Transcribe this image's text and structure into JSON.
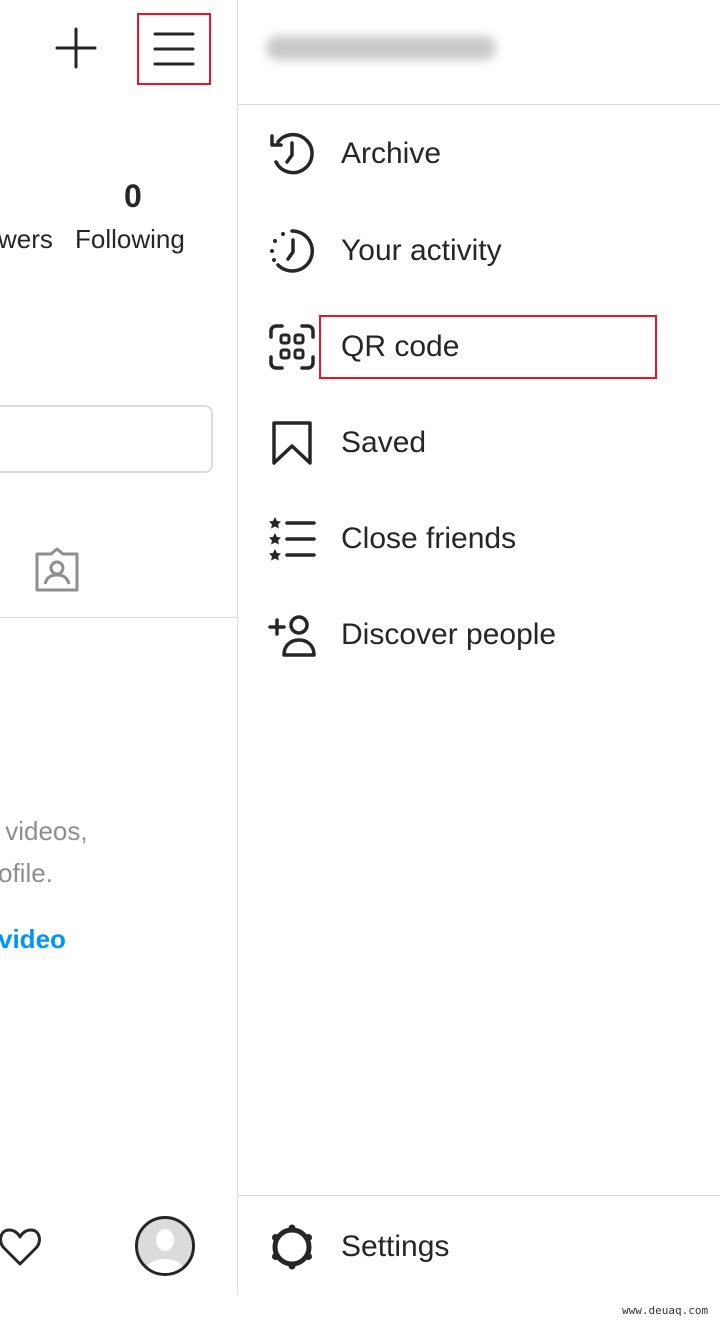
{
  "profile": {
    "stats": [
      {
        "label_partial": "wers"
      },
      {
        "value": "0",
        "label": "Following"
      }
    ],
    "empty_text_line1": " videos,",
    "empty_text_line2": "ofile.",
    "empty_link": "video"
  },
  "drawer": {
    "username_blurred": "",
    "items": [
      {
        "label": "Archive",
        "icon": "archive-icon"
      },
      {
        "label": "Your activity",
        "icon": "activity-icon"
      },
      {
        "label": "QR code",
        "icon": "qr-code-icon"
      },
      {
        "label": "Saved",
        "icon": "bookmark-icon"
      },
      {
        "label": "Close friends",
        "icon": "close-friends-icon"
      },
      {
        "label": "Discover people",
        "icon": "add-person-icon"
      }
    ],
    "settings": {
      "label": "Settings",
      "icon": "gear-icon"
    }
  },
  "watermark": "www.deuaq.com",
  "colors": {
    "highlight": "#e0192b",
    "link": "#0095f6",
    "divider": "#dbdbdb"
  }
}
